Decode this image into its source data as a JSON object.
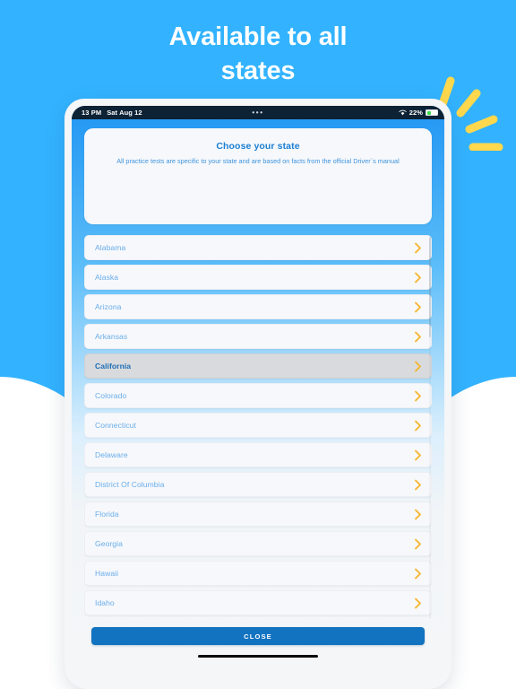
{
  "page": {
    "headline": "Available to all\nstates",
    "headline_line1": "Available to all",
    "headline_line2": "states",
    "background_color": "#33b3ff",
    "accent_color": "#1273c0",
    "chevron_color": "#f5b731",
    "sparkle_color": "#ffd84d"
  },
  "status_bar": {
    "time": "13 PM",
    "date": "Sat Aug 12",
    "center_dots": "•••",
    "battery_percent": "22%",
    "wifi_icon": "wifi-icon",
    "battery_icon": "battery-icon"
  },
  "header_card": {
    "title": "Choose your state",
    "subtitle": "All practice tests are specific to your state and are based on facts from the official Driver`s manual"
  },
  "state_list": {
    "chevron_icon": "chevron-right-icon",
    "selected": "California",
    "items": [
      {
        "name": "Alabama",
        "selected": false
      },
      {
        "name": "Alaska",
        "selected": false
      },
      {
        "name": "Arizona",
        "selected": false
      },
      {
        "name": "Arkansas",
        "selected": false
      },
      {
        "name": "California",
        "selected": true
      },
      {
        "name": "Colorado",
        "selected": false
      },
      {
        "name": "Connecticut",
        "selected": false
      },
      {
        "name": "Delaware",
        "selected": false
      },
      {
        "name": "District Of Columbia",
        "selected": false
      },
      {
        "name": "Florida",
        "selected": false
      },
      {
        "name": "Georgia",
        "selected": false
      },
      {
        "name": "Hawaii",
        "selected": false
      },
      {
        "name": "Idaho",
        "selected": false
      }
    ]
  },
  "footer": {
    "close_label": "CLOSE"
  }
}
